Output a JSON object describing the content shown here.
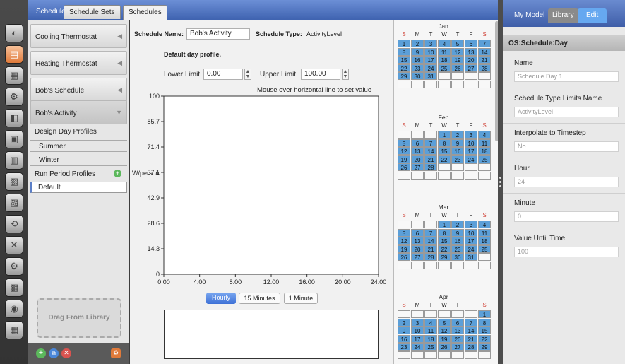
{
  "top_tabs": [
    "Schedules",
    "Schedule Sets"
  ],
  "main_tab": "Schedules",
  "left_list": {
    "items": [
      "Cooling Thermostat",
      "Heating Thermostat",
      "Bob's Schedule",
      "Bob's Activity"
    ],
    "design_day_header": "Design Day Profiles",
    "design_days": [
      "Summer",
      "Winter"
    ],
    "run_period_header": "Run Period Profiles",
    "run_period_default": "Default",
    "drag_label": "Drag From Library"
  },
  "schedule": {
    "name_label": "Schedule Name:",
    "name_value": "Bob's Activity",
    "type_label": "Schedule Type:",
    "type_value": "ActivityLevel",
    "profile_title": "Default day profile.",
    "lower_label": "Lower Limit:",
    "lower_value": "0.00",
    "upper_label": "Upper Limit:",
    "upper_value": "100.00",
    "hint": "Mouse over horizontal line to set value"
  },
  "chart_data": {
    "type": "line",
    "ylabel": "W/person",
    "ylim": [
      0,
      100
    ],
    "yticks": [
      "100",
      "85.7",
      "71.4",
      "57.1",
      "42.9",
      "28.6",
      "14.3",
      "0"
    ],
    "xticks": [
      "0:00",
      "4:00",
      "8:00",
      "12:00",
      "16:00",
      "20:00",
      "24:00"
    ],
    "series": []
  },
  "interval_buttons": [
    "Hourly",
    "15 Minutes",
    "1 Minute"
  ],
  "calendar": {
    "weekdays": [
      "S",
      "M",
      "T",
      "W",
      "T",
      "F",
      "S"
    ],
    "months": [
      {
        "name": "Jan",
        "start": 0,
        "days": 31
      },
      {
        "name": "Feb",
        "start": 3,
        "days": 28
      },
      {
        "name": "Mar",
        "start": 3,
        "days": 31
      },
      {
        "name": "Apr",
        "start": 6,
        "days": 29
      }
    ]
  },
  "right_panel": {
    "tabs": [
      "My Model",
      "Library",
      "Edit"
    ],
    "object_type": "OS:Schedule:Day",
    "fields": [
      {
        "label": "Name",
        "value": "Schedule Day 1"
      },
      {
        "label": "Schedule Type Limits Name",
        "value": "ActivityLevel"
      },
      {
        "label": "Interpolate to Timestep",
        "value": "No"
      },
      {
        "label": "Hour",
        "value": "24"
      },
      {
        "label": "Minute",
        "value": "0"
      },
      {
        "label": "Value Until Time",
        "value": "100"
      }
    ]
  },
  "colors": {
    "accent_blue": "#5b9fd8",
    "tab_blue": "#3f63b0",
    "weekend_red": "#d0453a"
  },
  "icons": [
    "site-icon",
    "schedules-icon",
    "constructions-icon",
    "loads-icon",
    "space-types-icon",
    "geometry-icon",
    "facility-icon",
    "spaces-icon",
    "thermal-zones-icon",
    "hvac-icon",
    "output-variables-icon",
    "simulation-settings-icon",
    "scripts-icon",
    "run-icon",
    "results-icon"
  ]
}
